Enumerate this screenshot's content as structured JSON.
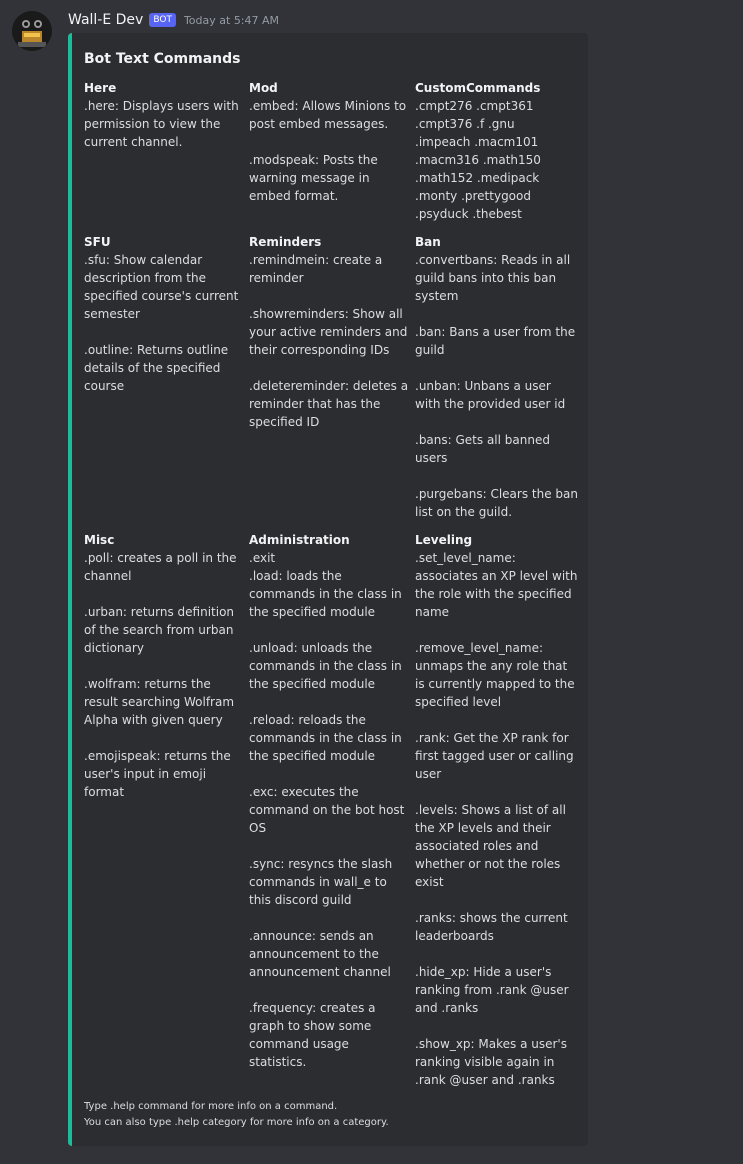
{
  "message": {
    "author": "Wall-E Dev",
    "bot_tag": "BOT",
    "timestamp": "Today at 5:47 AM"
  },
  "embed": {
    "title": "Bot Text Commands",
    "accent_color": "#1abc9c",
    "fields": [
      {
        "name": "Here",
        "value": ".here: Displays users with permission to view the current channel."
      },
      {
        "name": "Mod",
        "value": ".embed: Allows Minions to post embed messages.\n\n.modspeak: Posts the warning message in embed format."
      },
      {
        "name": "CustomCommands",
        "value": ".cmpt276  .cmpt361\n.cmpt376  .f  .gnu\n.impeach  .macm101\n.macm316  .math150\n.math152  .medipack\n.monty  .prettygood\n.psyduck  .thebest"
      },
      {
        "name": "SFU",
        "value": ".sfu: Show calendar description from the specified course's current semester\n\n.outline: Returns outline details of the specified course"
      },
      {
        "name": "Reminders",
        "value": ".remindmein: create a reminder\n\n.showreminders: Show all your active reminders and their corresponding IDs\n\n.deletereminder: deletes a reminder that has the specified ID"
      },
      {
        "name": "Ban",
        "value": ".convertbans: Reads in all guild bans into this ban system\n\n.ban: Bans a user from the guild\n\n.unban: Unbans a user with the provided user id\n\n.bans: Gets all banned users\n\n.purgebans: Clears the ban list on the guild."
      },
      {
        "name": "Misc",
        "value": ".poll: creates a poll in the channel\n\n.urban: returns definition of the search from urban dictionary\n\n.wolfram: returns the result searching Wolfram Alpha with given query\n\n.emojispeak: returns the user's input in emoji format"
      },
      {
        "name": "Administration",
        "value": ".exit\n.load: loads the commands in the class in the specified module\n\n.unload: unloads the commands in the class in the specified module\n\n.reload: reloads the commands in the class in the specified module\n\n.exc: executes the command on the bot host OS\n\n.sync: resyncs the slash commands in wall_e to this discord guild\n\n.announce: sends an announcement to the announcement channel\n\n.frequency: creates a graph to show some command usage statistics."
      },
      {
        "name": "Leveling",
        "value": ".set_level_name: associates an XP level with the role with the specified name\n\n.remove_level_name: unmaps the any role that is currently mapped to the specified level\n\n.rank: Get the XP rank for first tagged user or calling user\n\n.levels: Shows a list of all the XP levels and their associated roles and whether or not the roles exist\n\n.ranks: shows the current leaderboards\n\n.hide_xp: Hide a user's ranking from .rank @user and .ranks\n\n.show_xp: Makes a user's ranking visible again in .rank @user and .ranks"
      }
    ],
    "footer": {
      "line1": "Type .help command for more info on a command.",
      "line2": "You can also type .help category for more info on a category."
    }
  }
}
